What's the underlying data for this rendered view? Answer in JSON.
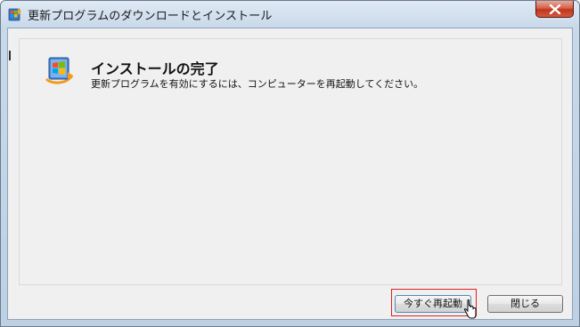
{
  "window": {
    "title": "更新プログラムのダウンロードとインストール"
  },
  "content": {
    "heading": "インストールの完了",
    "message": "更新プログラムを有効にするには、コンピューターを再起動してください。"
  },
  "buttons": {
    "restart_now": "今すぐ再起動",
    "close": "閉じる"
  },
  "icons": {
    "title": "windows-update-icon",
    "header": "windows-update-icon",
    "close": "close-icon",
    "cursor": "mouse-pointer-icon"
  },
  "colors": {
    "highlight": "#e02020",
    "close_button": "#c1351b"
  }
}
